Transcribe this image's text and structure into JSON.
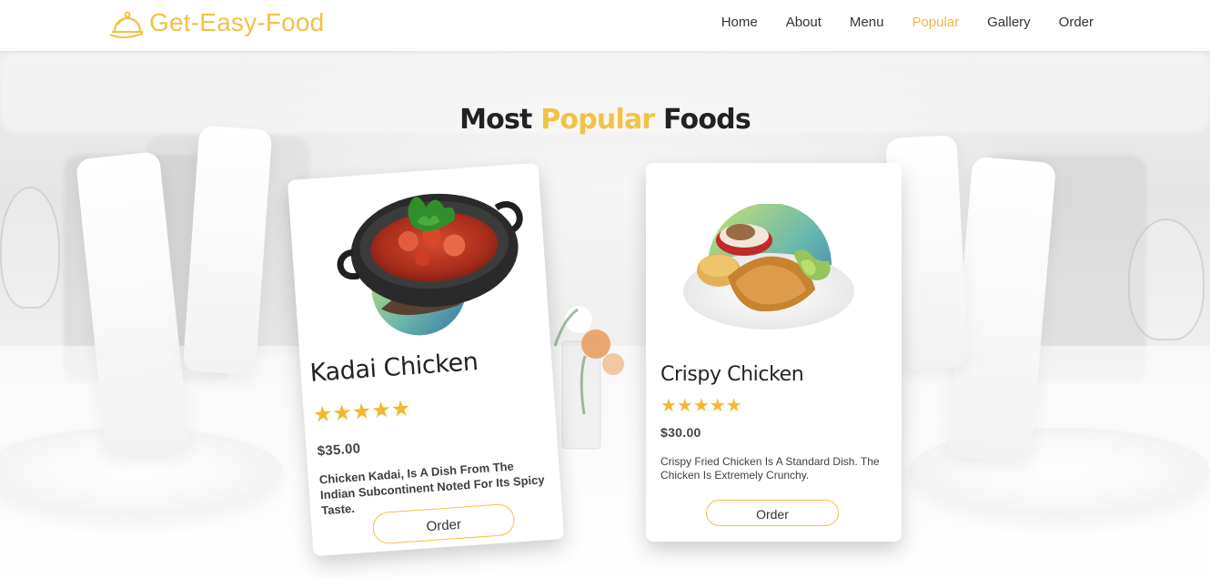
{
  "app": {
    "brand": "Get-Easy-Food"
  },
  "nav": {
    "items": [
      {
        "label": "Home",
        "active": false
      },
      {
        "label": "About",
        "active": false
      },
      {
        "label": "Menu",
        "active": false
      },
      {
        "label": "Popular",
        "active": true
      },
      {
        "label": "Gallery",
        "active": false
      },
      {
        "label": "Order",
        "active": false
      }
    ]
  },
  "section": {
    "title_prefix": "Most",
    "title_accent": "Popular",
    "title_suffix": "Foods"
  },
  "cards": [
    {
      "title": "Kadai Chicken",
      "rating": 5,
      "stars": "★★★★★",
      "price": "$35.00",
      "description": "Chicken Kadai, Is A Dish From The Indian Subcontinent Noted For Its Spicy Taste.",
      "button_label": "Order",
      "image_icon": "kadai-chicken-dish-icon"
    },
    {
      "title": "Crispy Chicken",
      "rating": 5,
      "stars": "★★★★★",
      "price": "$30.00",
      "description": "Crispy Fried Chicken Is A Standard Dish. The Chicken Is Extremely Crunchy.",
      "button_label": "Order",
      "image_icon": "crispy-chicken-plate-icon"
    }
  ],
  "colors": {
    "accent": "#f2c245",
    "star": "#f4b72f",
    "text": "#222222",
    "nav_active": "#f3b63b"
  }
}
